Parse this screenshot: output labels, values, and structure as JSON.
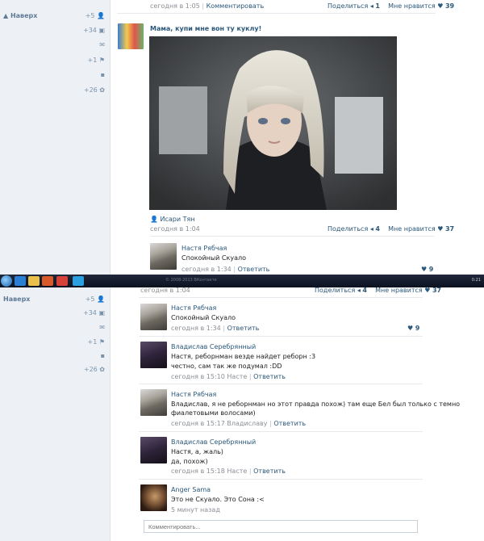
{
  "screen1": {
    "left": {
      "back_label": "Наверх",
      "counts": [
        "+5",
        "+34",
        "",
        "+1",
        "",
        "+26"
      ]
    },
    "top_meta": {
      "date": "сегодня в 1:05",
      "comment_link": "Комментировать",
      "share_label": "Поделиться",
      "share_count": "1",
      "like_label": "Мне нравится",
      "like_count": "39"
    },
    "post": {
      "title": "Мама, купи мне вон ту куклу!",
      "author": "Исари Тян",
      "date": "сегодня в 1:04",
      "share_label": "Поделиться",
      "share_count": "4",
      "like_label": "Мне нравится",
      "like_count": "37"
    },
    "comment": {
      "author": "Настя Рябчая",
      "text": "Спокойный Скуало",
      "date": "сегодня в 1:34",
      "reply": "Ответить",
      "likes": "9"
    }
  },
  "taskbar": {
    "blurred_text": "© 2008-2013 ВКонтакте",
    "time": "0:21"
  },
  "screen2": {
    "left": {
      "back_label": "Наверх",
      "counts": [
        "+5",
        "+34",
        "",
        "+1",
        "",
        "+26"
      ]
    },
    "top_meta": {
      "date": "сегодня в 1:04",
      "share_label": "Поделиться",
      "share_count": "4",
      "like_label": "Мне нравится",
      "like_count": "37"
    },
    "comments": [
      {
        "author": "Настя Рябчая",
        "lines": [
          "Спокойный Скуало"
        ],
        "date": "сегодня в 1:34",
        "to": "",
        "reply": "Ответить",
        "likes": "9"
      },
      {
        "author": "Владислав Серебрянный",
        "lines": [
          "Настя, реборнман везде найдет реборн :3",
          "честно, сам так же подумал :DD"
        ],
        "date": "сегодня в 15:10",
        "to": "Насте",
        "reply": "Ответить",
        "likes": ""
      },
      {
        "author": "Настя Рябчая",
        "lines": [
          "Владислав, я не реборнман но этот правда похож) там еще Бел был только с темно",
          "фиалетовыми волосами)"
        ],
        "date": "сегодня в 15:17",
        "to": "Владиславу",
        "reply": "Ответить",
        "likes": ""
      },
      {
        "author": "Владислав Серебрянный",
        "lines": [
          "Настя, а, жаль)",
          "да, похож)"
        ],
        "date": "сегодня в 15:18",
        "to": "Насте",
        "reply": "Ответить",
        "likes": ""
      },
      {
        "author": "Anger Sama",
        "lines": [
          "Это не Скуало. Это Сона :<"
        ],
        "date": "5 минут назад",
        "to": "",
        "reply": "",
        "likes": ""
      }
    ],
    "input_placeholder": "Комментировать..."
  },
  "colors": {
    "link": "#2b587a",
    "grey": "#8a8f95",
    "sidebar_bg": "#edf1f5"
  },
  "icons": [
    "user-icon",
    "camera-icon",
    "mail-icon",
    "friends-icon",
    "chat-icon",
    "gear-icon",
    "heart-icon",
    "share-icon"
  ]
}
